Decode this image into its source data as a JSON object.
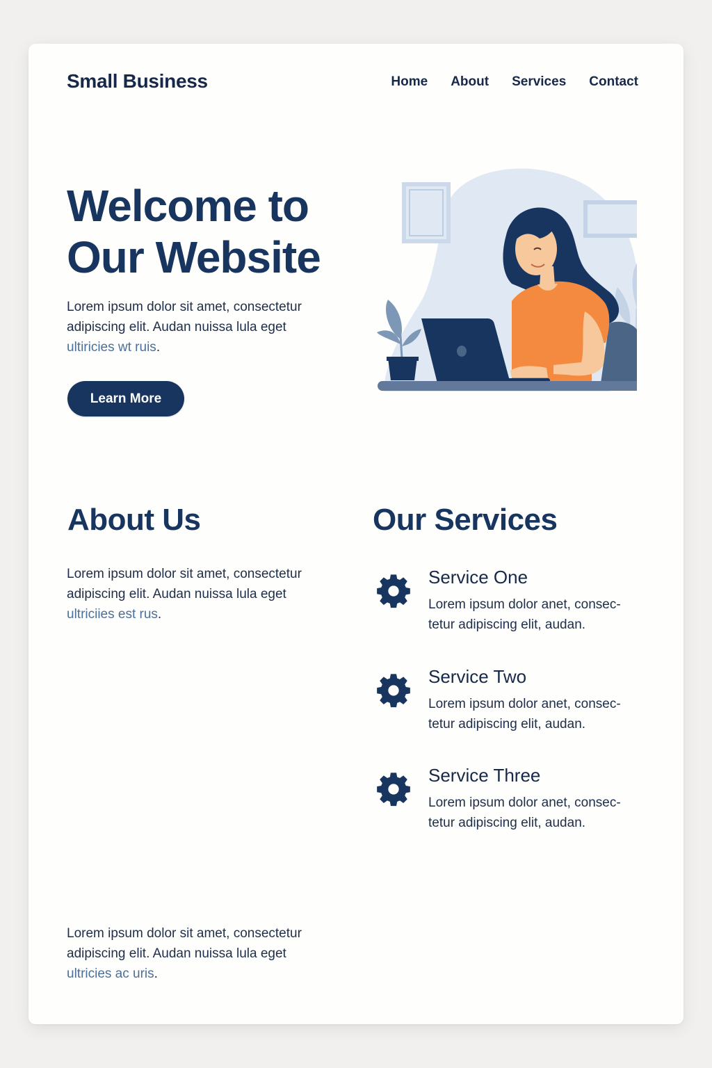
{
  "brand": "Small Business",
  "nav": [
    "Home",
    "About",
    "Services",
    "Contact"
  ],
  "hero": {
    "title_line1": "Welcome to",
    "title_line2": "Our Website",
    "text": "Lorem ipsum dolor sit amet, consectetur adipiscing elit. Audan nuissa lula eget ",
    "link": "ultiricies wt ruis",
    "after": ".",
    "button": "Learn More"
  },
  "about": {
    "title": "About Us",
    "text": "Lorem ipsum dolor sit amet, consectetur adipiscing elit. Audan nuissa lula eget ",
    "link": "ultriciies est rus",
    "after": "."
  },
  "services": {
    "title": "Our Services",
    "items": [
      {
        "title": "Service One",
        "desc": "Lorem ipsum dolor anet, consec-tetur adipiscing elit, audan.",
        "icon": "gear-icon"
      },
      {
        "title": "Service Two",
        "desc": "Lorem ipsum dolor anet, consec-tetur adipiscing elit, audan.",
        "icon": "gear-icon"
      },
      {
        "title": "Service Three",
        "desc": "Lorem ipsum dolor anet, consec-tetur adipiscing elit, audan.",
        "icon": "gear-icon"
      }
    ]
  },
  "footer": {
    "text": "Lorem ipsum dolor sit amet, consectetur adipiscing elit. Audan nuissa lula eget ",
    "link": "ultricies ac uris",
    "after": "."
  },
  "colors": {
    "primary": "#17355e",
    "link": "#4c6f97",
    "shirt": "#f48a3f",
    "blob": "#dfe8f3"
  }
}
